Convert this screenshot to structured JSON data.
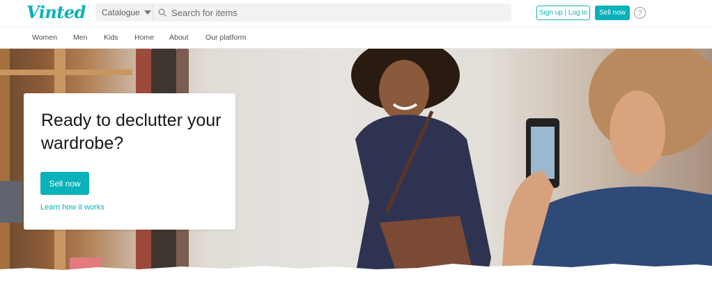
{
  "brand": {
    "logo_text": "Vinted",
    "accent": "#09b1ba"
  },
  "header": {
    "catalogue_label": "Catalogue",
    "search_placeholder": "Search for items",
    "signup_label": "Sign up | Log in",
    "sell_label": "Sell now",
    "help_glyph": "?"
  },
  "nav": {
    "items": [
      {
        "label": "Women"
      },
      {
        "label": "Men"
      },
      {
        "label": "Kids"
      },
      {
        "label": "Home"
      },
      {
        "label": "About"
      },
      {
        "label": "Our platform"
      }
    ]
  },
  "hero": {
    "title": "Ready to declutter your wardrobe?",
    "button_label": "Sell now",
    "link_label": "Learn how it works"
  },
  "icons": [
    "logo",
    "chevron-down-icon",
    "search-icon",
    "help-icon"
  ]
}
